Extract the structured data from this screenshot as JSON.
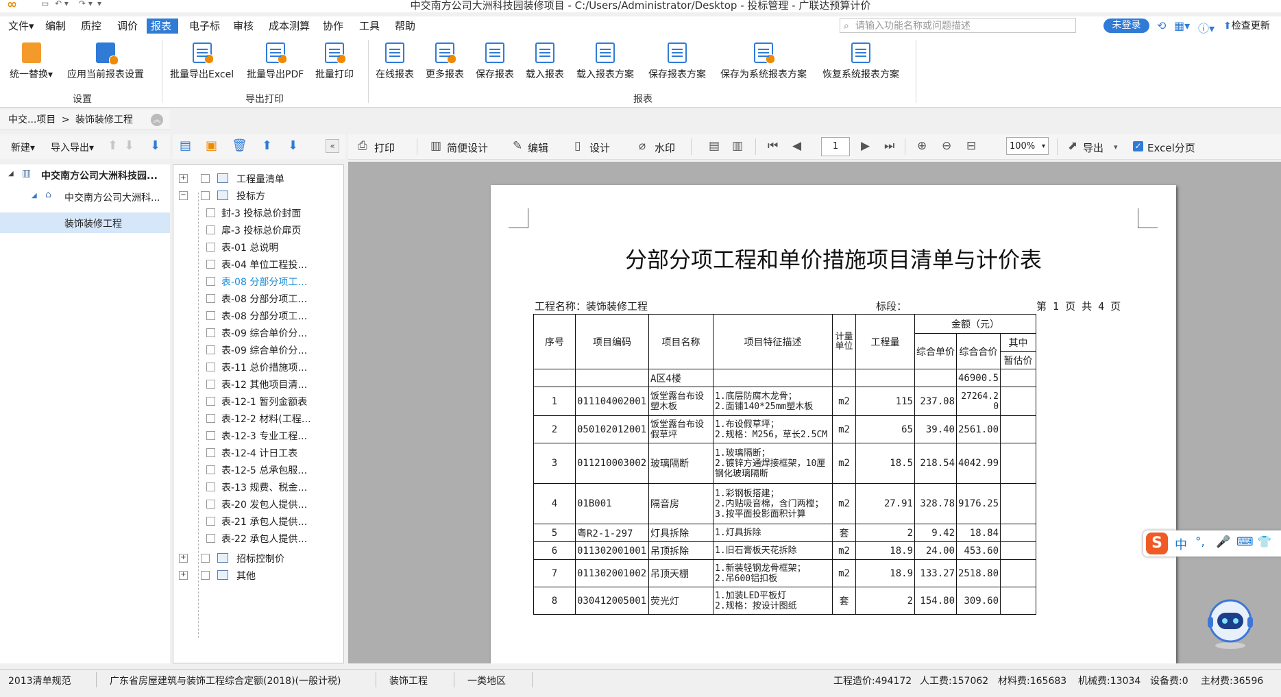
{
  "window": {
    "title": "中交南方公司大洲科技园装修项目 - C:/Users/Administrator/Desktop - 投标管理 - 广联达预算计价"
  },
  "menu": {
    "items": [
      "文件▾",
      "编制",
      "质控",
      "调价",
      "报表",
      "电子标",
      "审核",
      "成本测算",
      "协作",
      "工具",
      "帮助"
    ],
    "active": "报表",
    "search_placeholder": "请输入功能名称或问题描述",
    "login_label": "未登录",
    "check_update_label": "检查更新"
  },
  "ribbon": {
    "buttons": [
      "统一替换▾",
      "应用当前报表设置",
      "批量导出Excel",
      "批量导出PDF",
      "批量打印",
      "在线报表",
      "更多报表",
      "保存报表",
      "载入报表",
      "载入报表方案",
      "保存报表方案",
      "保存为系统报表方案",
      "恢复系统报表方案"
    ],
    "groups": [
      "设置",
      "导出打印",
      "报表"
    ]
  },
  "breadcrumb": {
    "root": "中交...项目",
    "sep": ">",
    "current": "装饰装修工程"
  },
  "left_toolbar": {
    "new_label": "新建▾",
    "import_label": "导入导出▾"
  },
  "project_tree": [
    "中交南方公司大洲科技园...",
    "中交南方公司大洲科...",
    "装饰装修工程"
  ],
  "report_tree": [
    "工程量清单",
    "投标方",
    "封-3 投标总价封面",
    "扉-3 投标总价扉页",
    "表-01 总说明",
    "表-04 单位工程投…",
    "表-08 分部分项工…",
    "表-08 分部分项工…",
    "表-08 分部分项工…",
    "表-09 综合单价分…",
    "表-09 综合单价分…",
    "表-11 总价措施项…",
    "表-12 其他项目清…",
    "表-12-1 暂列金额表",
    "表-12-2 材料(工程…",
    "表-12-3 专业工程…",
    "表-12-4 计日工表",
    "表-12-5 总承包服…",
    "表-13 规费、税金…",
    "表-20 发包人提供…",
    "表-21 承包人提供…",
    "表-22 承包人提供…",
    "招标控制价",
    "其他"
  ],
  "doc_toolbar": {
    "print": "打印",
    "simple_design": "简便设计",
    "edit": "编辑",
    "design": "设计",
    "watermark": "水印",
    "page": "1",
    "zoom": "100%",
    "export": "导出",
    "excel_paging": "Excel分页"
  },
  "document": {
    "title": "分部分项工程和单价措施项目清单与计价表",
    "project_name": "工程名称：装饰装修工程",
    "section": "标段：",
    "page_info": "第 1 页  共 4 页",
    "headers": {
      "seq": "序号",
      "code": "项目编码",
      "name": "项目名称",
      "feature": "项目特征描述",
      "unit": "计量单位",
      "qty": "工程量",
      "amount": "金额（元）",
      "unit_price": "综合单价",
      "total": "综合合价",
      "of_which": "其中",
      "provisional": "暂估价"
    },
    "group_row": {
      "name": "A区4楼",
      "total": "46900.5"
    },
    "rows": [
      {
        "seq": "1",
        "code": "011104002001",
        "name": "饭堂露台布设塑木板",
        "feature": "1.底层防腐木龙骨；\n2.面铺140*25mm塑木板",
        "unit": "m2",
        "qty": "115",
        "price": "237.08",
        "total": "27264.20"
      },
      {
        "seq": "2",
        "code": "050102012001",
        "name": "饭堂露台布设假草坪",
        "feature": "1.布设假草坪；\n2.规格：M256，草长2.5CM",
        "unit": "m2",
        "qty": "65",
        "price": "39.40",
        "total": "2561.00"
      },
      {
        "seq": "3",
        "code": "011210003002",
        "name": "玻璃隔断",
        "feature": "1.玻璃隔断；\n2.镀锌方通焊接框架，10厘钢化玻璃隔断",
        "unit": "m2",
        "qty": "18.5",
        "price": "218.54",
        "total": "4042.99"
      },
      {
        "seq": "4",
        "code": "01B001",
        "name": "隔音房",
        "feature": "1.彩钢板搭建；\n2.内贴吸音棉，含门两樘；\n3.按平面投影面积计算",
        "unit": "m2",
        "qty": "27.91",
        "price": "328.78",
        "total": "9176.25"
      },
      {
        "seq": "5",
        "code": "粤R2-1-297",
        "name": "灯具拆除",
        "feature": "1.灯具拆除",
        "unit": "套",
        "qty": "2",
        "price": "9.42",
        "total": "18.84"
      },
      {
        "seq": "6",
        "code": "011302001001",
        "name": "吊顶拆除",
        "feature": "1.旧石膏板天花拆除",
        "unit": "m2",
        "qty": "18.9",
        "price": "24.00",
        "total": "453.60"
      },
      {
        "seq": "7",
        "code": "011302001002",
        "name": "吊顶天棚",
        "feature": "1.新装轻钢龙骨框架；\n2.吊600铝扣板",
        "unit": "m2",
        "qty": "18.9",
        "price": "133.27",
        "total": "2518.80"
      },
      {
        "seq": "8",
        "code": "030412005001",
        "name": "荧光灯",
        "feature": "1.加装LED平板灯\n2.规格：按设计图纸",
        "unit": "套",
        "qty": "2",
        "price": "154.80",
        "total": "309.60"
      }
    ]
  },
  "ime": {
    "lang": "中"
  },
  "status": {
    "spec": "2013清单规范",
    "quota": "广东省房屋建筑与装饰工程综合定额(2018)(一般计税)",
    "discipline": "装饰工程",
    "region": "一类地区",
    "cost": "工程造价:494172",
    "labor": "人工费:157062",
    "material": "材料费:165683",
    "machine": "机械费:13034",
    "equipment": "设备费:0",
    "main_material": "主材费:36596"
  }
}
